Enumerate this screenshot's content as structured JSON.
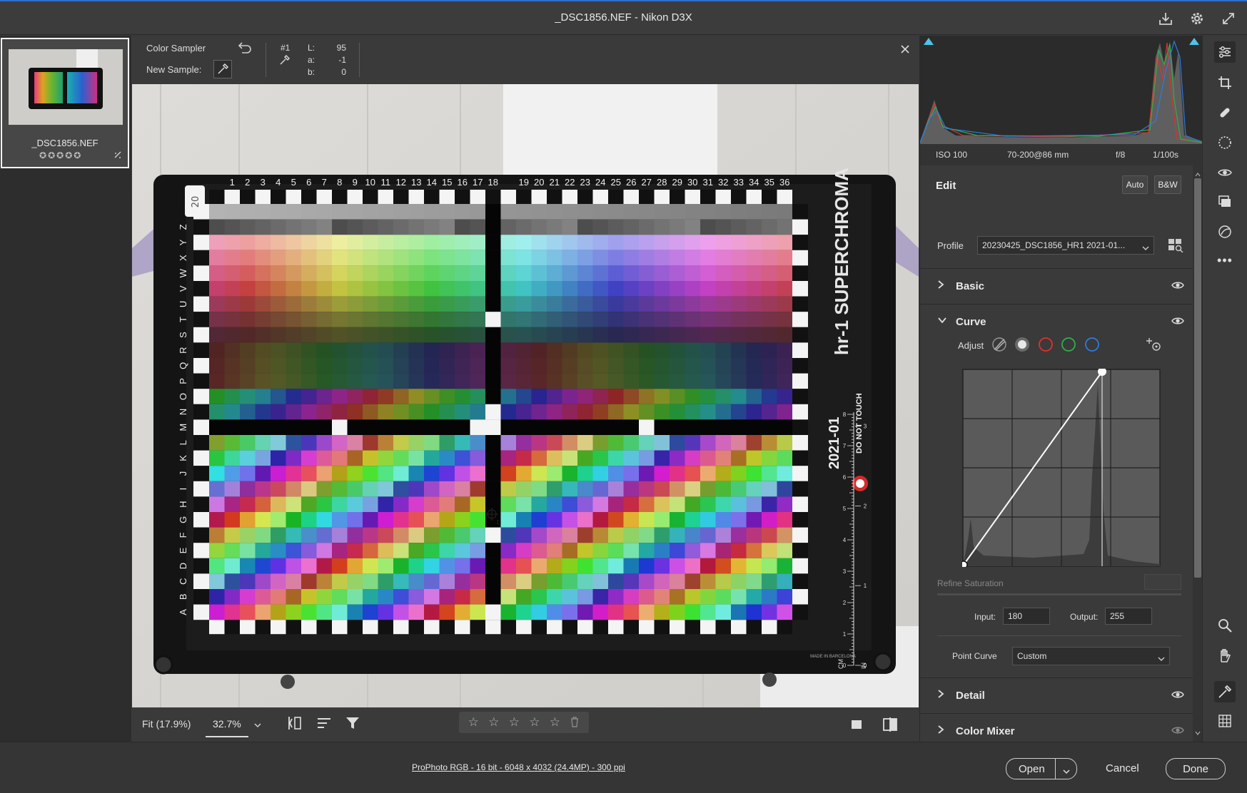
{
  "window": {
    "title": "_DSC1856.NEF  -  Nikon D3X"
  },
  "filmstrip": {
    "filename": "_DSC1856.NEF",
    "rating_stars": 5
  },
  "sampler": {
    "title": "Color Sampler",
    "new_sample_label": "New Sample:",
    "sample_id": "#1",
    "L_label": "L:",
    "L_value": "95",
    "a_label": "a:",
    "a_value": "-1",
    "b_label": "b:",
    "b_value": "0"
  },
  "chart_photo": {
    "top_numbers": [
      "1",
      "2",
      "3",
      "4",
      "5",
      "6",
      "7",
      "8",
      "9",
      "10",
      "11",
      "12",
      "13",
      "14",
      "15",
      "16",
      "17",
      "18",
      "19",
      "20",
      "21",
      "22",
      "23",
      "24",
      "25",
      "26",
      "27",
      "28",
      "29",
      "30",
      "31",
      "32",
      "33",
      "34",
      "35",
      "36"
    ],
    "row_letters": [
      "Z",
      "Y",
      "X",
      "W",
      "V",
      "U",
      "T",
      "S",
      "R",
      "Q",
      "P",
      "O",
      "N",
      "M",
      "L",
      "K",
      "J",
      "I",
      "H",
      "G",
      "F",
      "E",
      "D",
      "C",
      "B",
      "A"
    ],
    "brand": "hr-1 SUPERCHROMA",
    "version": "2021-01",
    "warning": "DO NOT TOUCH",
    "made_in": "MADE IN BARCELONA",
    "corner_mark": "20",
    "ruler_label": "CM",
    "ruler_label_2": "IN",
    "ruler_ticks_cm": [
      "0",
      "1",
      "2",
      "3",
      "4",
      "5",
      "6",
      "7",
      "8"
    ],
    "ruler_ticks_in": [
      "0",
      "1",
      "2",
      "3"
    ],
    "sampler_marker": "1"
  },
  "bottombar": {
    "fit_label": "Fit (17.9%)",
    "zoom_value": "32.7%"
  },
  "status": {
    "workflow_link": "ProPhoto RGB - 16 bit - 6048 x 4032 (24.4MP) - 300 ppi",
    "open_label": "Open",
    "cancel_label": "Cancel",
    "done_label": "Done"
  },
  "exif": {
    "iso": "ISO 100",
    "lens": "70-200@86 mm",
    "aperture": "f/8",
    "shutter": "1/100s"
  },
  "edit": {
    "title": "Edit",
    "auto_label": "Auto",
    "bw_label": "B&W",
    "profile_label": "Profile",
    "profile_value": "20230425_DSC1856_HR1 2021-01...",
    "sections": {
      "basic": "Basic",
      "curve": "Curve",
      "detail": "Detail",
      "color_mixer": "Color Mixer"
    },
    "curve": {
      "adjust_label": "Adjust",
      "refine_saturation_label": "Refine Saturation",
      "input_label": "Input:",
      "input_value": "180",
      "output_label": "Output:",
      "output_value": "255",
      "point_curve_label": "Point Curve",
      "point_curve_value": "Custom"
    }
  },
  "colors": {
    "accent": "#2f6fd0",
    "red_channel": "#e03030",
    "green_channel": "#2db04a",
    "blue_channel": "#2f7ae0"
  }
}
